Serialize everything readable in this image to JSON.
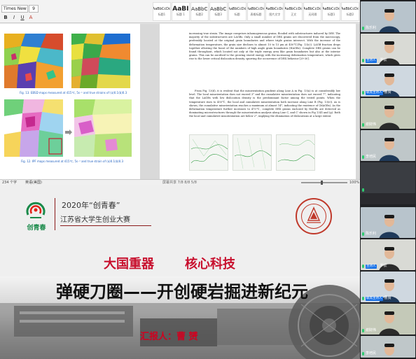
{
  "word": {
    "font_name": "Times New R",
    "font_size": "9",
    "format_buttons": [
      "B",
      "I",
      "U",
      "A"
    ],
    "styles": [
      {
        "sample": "AaBbCcDd",
        "name": "标题1",
        "size": "small"
      },
      {
        "sample": "AaBI",
        "name": "标题 1",
        "size": "big"
      },
      {
        "sample": "AaBbC",
        "name": "标题2",
        "size": "mid"
      },
      {
        "sample": "AaBbC",
        "name": "标题3",
        "size": "mid"
      },
      {
        "sample": "AaBbCcDd",
        "name": "标题",
        "size": "small"
      },
      {
        "sample": "AaBbCcDd",
        "name": "表格标题",
        "size": "small"
      },
      {
        "sample": "AaBbCcDd",
        "name": "图片文字",
        "size": "small"
      },
      {
        "sample": "AaBbCcDd",
        "name": "正文",
        "size": "small"
      },
      {
        "sample": "AaBbCcDd",
        "name": "无间隔",
        "size": "small"
      },
      {
        "sample": "AaBbCcDd",
        "name": "标题1",
        "size": "small"
      },
      {
        "sample": "AaBbCcDd",
        "name": "标题2",
        "size": "small"
      }
    ],
    "captions": [
      "Fig. 13. EBSD maps measured at 415℃, 5s⁻¹ and true strains of (a)0.1(b)0.3",
      "Fig. 12. IPF maps measured at 415℃, 5s⁻¹ and true strain of (a)0.1(b)0.3"
    ],
    "paragraphs": [
      "increasing true strain. The image comprises inhomogeneous grains, flooded with substructures induced by DRV. The majority of the substructures are LAGBs. Only a small number of DRX grains are discovered from the microscopy, preferably located at the original grain boundaries and where triple grains intersect. With the increase of the deformation temperature, the grain size declines to almost 10 to 15 μm at 450℃(Fig. 13(c)). LAGB fraction drops together allowing the boost of the numbers of high angle grain boundaries (HAGBs). Complete DRX grains can be found throughout, which located not only at the triple energy area like grain boundaries but also at the interior grains. This can be ascribed to the growing stored energy with the increasing deformation temperature, which gives rise to the lower critical dislocation density, spurring the occurrence of DRX behavior [29-30].",
      "From Fig. 13(d), it is evident that the misorientation gradient along Line A in Fig. 13(a) is at considerably low level. The local misorientation does not exceed 3° and the cumulative misorientation does not exceed 7°, indicating that the LAGBs with low dislocation density is the predominant factor among the tested points. When the temperature rises to 450℃, the local and cumulative misorientation both increase along Line B (Fig. 13(e)). As is shown, the cumulative misorientation reaches a maximum at almost 14°, indicating the existence of (MAGBs). As the deformation temperature further increases to 470℃, complete DRX grains enclosed by HAGBs are detected as dominating microstructures through the misorientation analysis along Line C, and C' shown in Fig 13(f) and (g). Both the local and cumulative misorientation are below 2°, implying the elimination of dislocations at a large extent."
    ],
    "status": {
      "page_info": "234 个字",
      "language": "英语(美国)",
      "center_text": "屏幕共享 7/8 8/8 5/8",
      "zoom": "100%"
    }
  },
  "slide": {
    "logo_text": "创青春",
    "year_line": "2020年“创青春”",
    "contest_line": "江苏省大学生创业大赛",
    "slogan_left": "大国重器",
    "slogan_right": "核心科技",
    "title": "弹硬刀圈——开创硬岩掘进新纪元",
    "reporter": "汇报人：曹  赟"
  },
  "participants": [
    {
      "name": "陈乐利",
      "host": false
    },
    {
      "name": "",
      "host": true,
      "extra": "罗钦"
    },
    {
      "name": "曹赟",
      "host": false,
      "badge": "联席主持人"
    },
    {
      "name": "谢财伟",
      "host": false
    },
    {
      "name": "李培民",
      "host": false
    },
    {
      "name": "",
      "host": false
    },
    {
      "name": "陈乐利",
      "host": false
    },
    {
      "name": "",
      "host": true,
      "extra": "罗钦"
    },
    {
      "name": "曹赟",
      "host": false,
      "badge": "联席主持人"
    },
    {
      "name": "谢财伟",
      "host": false
    },
    {
      "name": "李培民",
      "host": false
    }
  ],
  "labels": {
    "host": "主持人",
    "cohost": "联席主持人"
  }
}
